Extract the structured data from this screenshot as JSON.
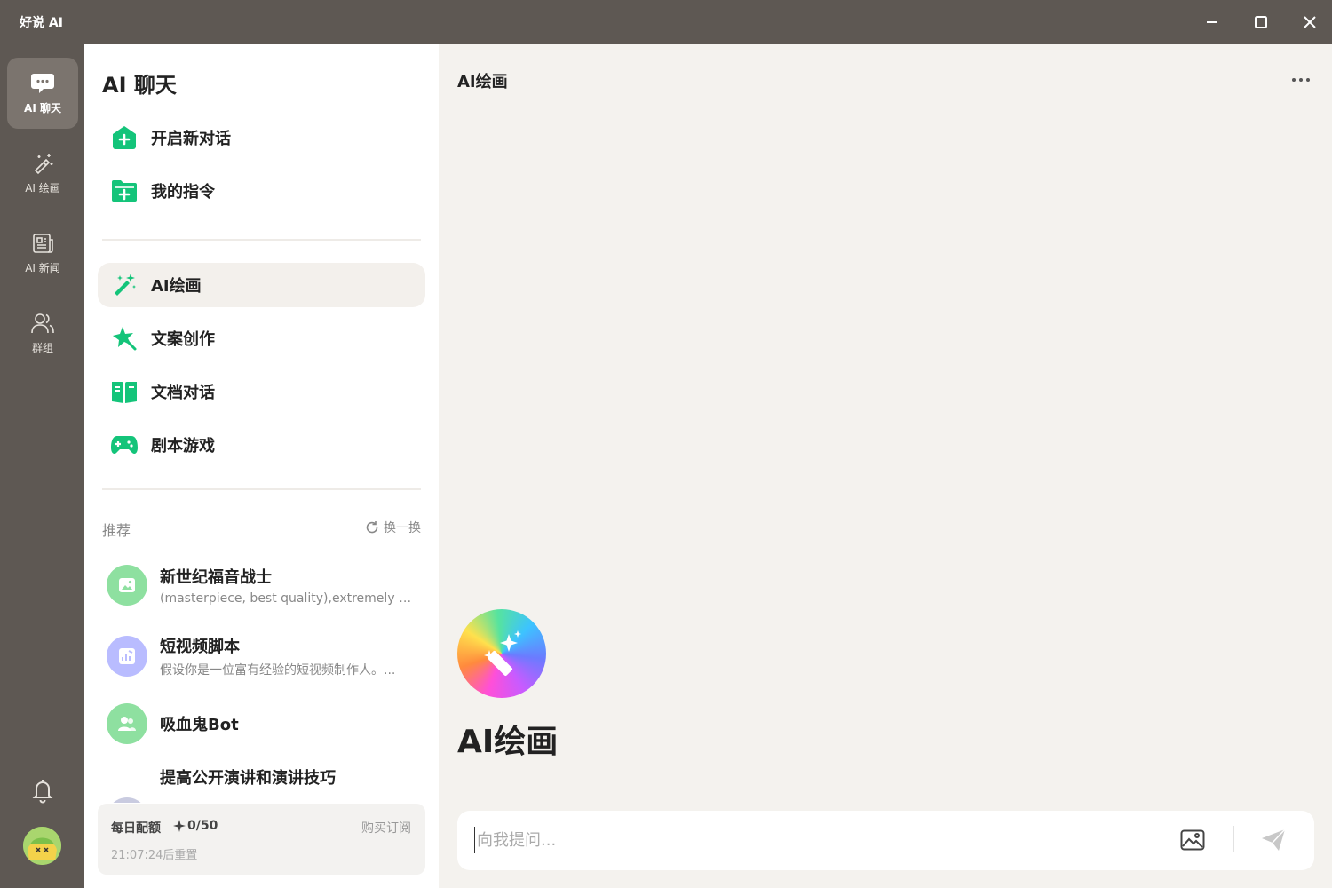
{
  "app": {
    "title": "好说 AI"
  },
  "window_controls": {
    "minimize": "minimize-icon",
    "maximize": "maximize-icon",
    "close": "close-icon"
  },
  "rail": {
    "items": [
      {
        "label": "AI 聊天",
        "icon": "chat-bubble-icon",
        "active": true
      },
      {
        "label": "AI 绘画",
        "icon": "magic-wand-icon",
        "active": false
      },
      {
        "label": "AI 新闻",
        "icon": "newspaper-icon",
        "active": false
      },
      {
        "label": "群组",
        "icon": "group-icon",
        "active": false
      }
    ],
    "bell_icon": "bell-icon",
    "avatar_icon": "user-avatar"
  },
  "panel": {
    "title": "AI 聊天",
    "actions": [
      {
        "label": "开启新对话",
        "icon": "new-chat-icon"
      },
      {
        "label": "我的指令",
        "icon": "folder-add-icon"
      }
    ],
    "tools": [
      {
        "label": "AI绘画",
        "icon": "magic-wand-icon",
        "active": true
      },
      {
        "label": "文案创作",
        "icon": "star-burst-icon",
        "active": false
      },
      {
        "label": "文档对话",
        "icon": "book-icon",
        "active": false
      },
      {
        "label": "剧本游戏",
        "icon": "gamepad-icon",
        "active": false
      }
    ],
    "recommend": {
      "title": "推荐",
      "refresh_label": "换一换",
      "items": [
        {
          "name": "新世纪福音战士",
          "desc": "(masterpiece, best quality),extremely det...",
          "color": "#8ee0a0",
          "icon": "image-icon"
        },
        {
          "name": "短视频脚本",
          "desc": "假设你是一位富有经验的短视频制作人。...",
          "color": "#b9bcff",
          "icon": "chart-icon"
        },
        {
          "name": "吸血鬼Bot",
          "desc": "",
          "color": "#8ee0a0",
          "icon": "people-icon"
        },
        {
          "name": "提高公开演讲和演讲技巧",
          "desc": "",
          "color": "#c9cbe0",
          "icon": "mic-icon"
        }
      ]
    },
    "quota": {
      "label": "每日配额",
      "count": "0/50",
      "buy_label": "购买订阅",
      "reset_text": "21:07:24后重置"
    }
  },
  "main": {
    "title": "AI绘画",
    "more_icon": "more-dots-icon",
    "hero_name": "AI绘画",
    "composer": {
      "placeholder": "向我提问...",
      "value": "",
      "image_icon": "image-upload-icon",
      "send_icon": "send-icon"
    }
  },
  "colors": {
    "accent": "#14c47a",
    "rail_bg": "#5e5853",
    "main_bg": "#f4f2ee"
  }
}
